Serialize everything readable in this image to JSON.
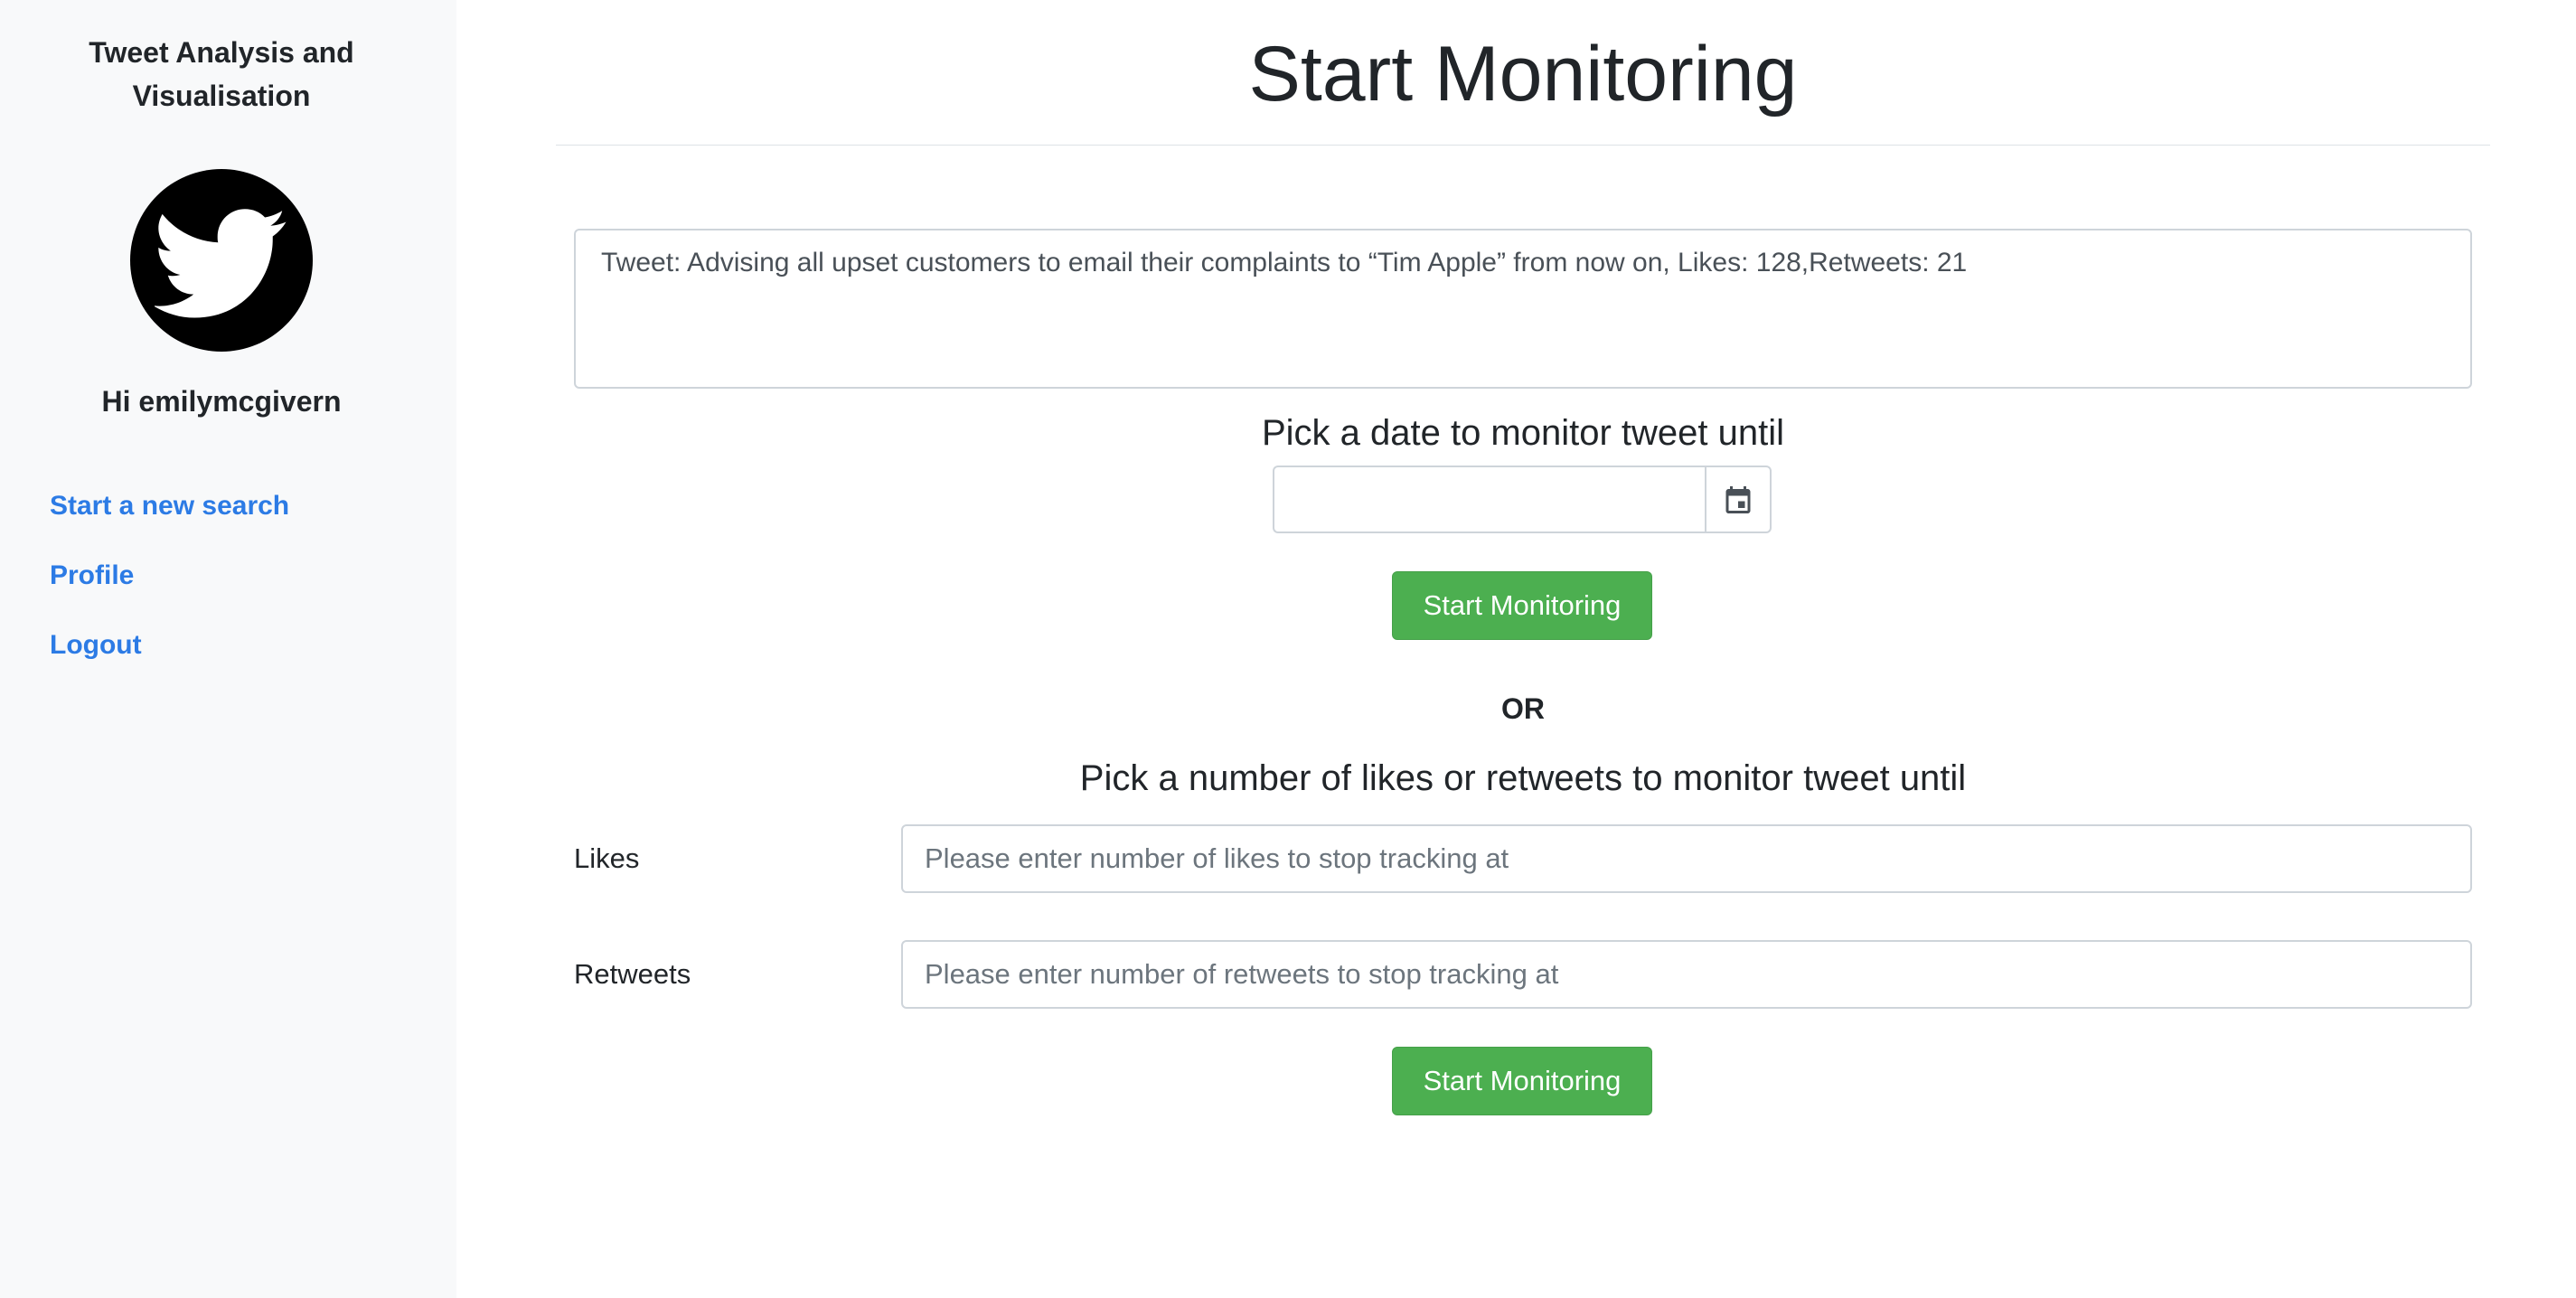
{
  "sidebar": {
    "app_title": "Tweet Analysis and Visualisation",
    "avatar_icon": "twitter-bird-icon",
    "greeting": "Hi emilymcgivern",
    "nav": [
      {
        "label": "Start a new search"
      },
      {
        "label": "Profile"
      },
      {
        "label": "Logout"
      }
    ],
    "link_color": "#2c7be5"
  },
  "main": {
    "title": "Start Monitoring",
    "tweet_text": "Tweet: Advising all upset customers to email their complaints to “Tim Apple” from now on, Likes: 128,Retweets: 21",
    "date_heading": "Pick a date to monitor tweet until",
    "date_value": "",
    "date_picker_icon": "calendar-icon",
    "start_button_label": "Start Monitoring",
    "or_label": "OR",
    "count_heading": "Pick a number of likes or retweets to monitor tweet until",
    "likes": {
      "label": "Likes",
      "placeholder": "Please enter number of likes to stop tracking at",
      "value": ""
    },
    "retweets": {
      "label": "Retweets",
      "placeholder": "Please enter number of retweets to stop tracking at",
      "value": ""
    },
    "button_color": "#4caf50"
  }
}
